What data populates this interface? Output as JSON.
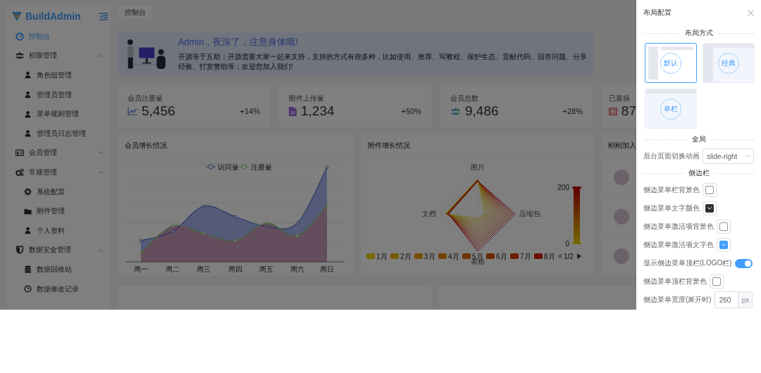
{
  "sidebar": {
    "logo": "BuildAdmin",
    "menu": [
      {
        "label": "控制台",
        "selected": true
      },
      {
        "label": "权限管理",
        "selected": false,
        "expanded": true,
        "children": [
          {
            "label": "角色组管理",
            "selected": false
          },
          {
            "label": "管理员管理",
            "selected": false
          },
          {
            "label": "菜单规则管理",
            "selected": false
          },
          {
            "label": "管理员日志管理",
            "selected": false
          }
        ]
      },
      {
        "label": "会员管理",
        "selected": false,
        "expanded": false
      },
      {
        "label": "常规管理",
        "selected": false,
        "expanded": true,
        "children": [
          {
            "label": "系统配置",
            "selected": false
          },
          {
            "label": "附件管理",
            "selected": false
          },
          {
            "label": "个人资料",
            "selected": false
          }
        ]
      },
      {
        "label": "数据安全管理",
        "selected": false,
        "expanded": true,
        "children": [
          {
            "label": "数据回收站",
            "selected": false
          },
          {
            "label": "数据修改记录",
            "selected": false
          }
        ]
      }
    ]
  },
  "tabs": [
    {
      "label": "控制台"
    }
  ],
  "banner": {
    "title": "Admin，夜深了，注意身体哦!",
    "text": "开源等于互助；开源需要大家一起来支持，支持的方式有很多种，比如使用、推荐、写教程、保护生态、贡献代码、回答问题、分享经验、打赏赞助等；欢迎您加入我们!"
  },
  "stats": [
    {
      "title": "会员注册量",
      "value": "5,456",
      "change": "+14%"
    },
    {
      "title": "附件上传量",
      "value": "1,234",
      "change": "+50%"
    },
    {
      "title": "会员总数",
      "value": "9,486",
      "change": "+28%"
    },
    {
      "title": "已装插",
      "value": "87"
    }
  ],
  "panels": [
    {
      "kind": "line",
      "title": "会员增长情况",
      "legend": [
        "访问量",
        "注册量"
      ],
      "categories": [
        "周一",
        "周二",
        "周三",
        "周四",
        "周五",
        "周六",
        "周日"
      ]
    },
    {
      "kind": "radar",
      "title": "附件增长情况",
      "indicators": [
        "图片",
        "压缩包",
        "表格",
        "文档"
      ],
      "range": [
        "200",
        "0"
      ],
      "legend": [
        {
          "label": "1月"
        },
        {
          "label": "2月"
        },
        {
          "label": "3月"
        },
        {
          "label": "4月"
        },
        {
          "label": "5月"
        },
        {
          "label": "6月"
        },
        {
          "label": "7月"
        },
        {
          "label": "8月"
        }
      ],
      "pager": "1/2"
    },
    {
      "kind": "list",
      "title": "刚刚加入"
    }
  ],
  "drawer": {
    "title": "布局配置",
    "sections": [
      {
        "heading": "布局方式",
        "layouts": [
          {
            "kind": "default",
            "label": "默认",
            "selected": true
          },
          {
            "kind": "classic",
            "label": "经典",
            "selected": false
          },
          {
            "kind": "single",
            "label": "单栏",
            "selected": false
          }
        ]
      },
      {
        "heading": "全局",
        "rows": [
          {
            "kind": "select",
            "label": "后台页面切换动画",
            "value": "slide-right"
          }
        ]
      },
      {
        "heading": "侧边栏",
        "rows": [
          {
            "kind": "color",
            "label": "侧边菜单栏背景色",
            "color": "#ffffff"
          },
          {
            "kind": "color",
            "label": "侧边菜单文字颜色",
            "color": "#303133"
          },
          {
            "kind": "color",
            "label": "侧边菜单激活项背景色",
            "color": "#ffffff"
          },
          {
            "kind": "color",
            "label": "侧边菜单激活项文字色",
            "color": "#409eff"
          },
          {
            "kind": "switch",
            "label": "显示侧边菜单顶栏(LOGO栏)",
            "on": true
          },
          {
            "kind": "color",
            "label": "侧边菜单顶栏背景色",
            "color": "#ffffff"
          },
          {
            "kind": "number",
            "label": "侧边菜单宽度(展开时)",
            "value": "260",
            "unit": "px"
          }
        ]
      }
    ]
  }
}
